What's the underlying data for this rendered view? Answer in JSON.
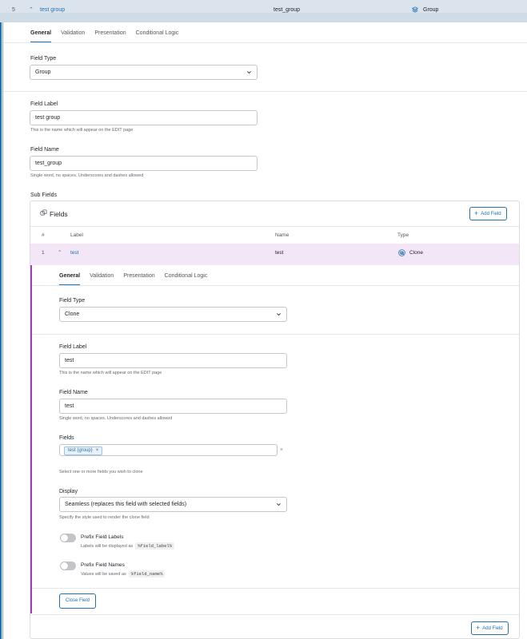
{
  "outer_row": {
    "num": "5",
    "label": "test group",
    "name": "test_group",
    "type": "Group"
  },
  "outer_tabs": [
    "General",
    "Validation",
    "Presentation",
    "Conditional Logic"
  ],
  "outer": {
    "field_type_label": "Field Type",
    "field_type_value": "Group",
    "field_label_label": "Field Label",
    "field_label_value": "test group",
    "field_label_help": "This is the name which will appear on the EDIT page",
    "field_name_label": "Field Name",
    "field_name_value": "test_group",
    "field_name_help": "Single word, no spaces. Underscores and dashes allowed",
    "sub_fields_label": "Sub Fields"
  },
  "sub_panel": {
    "title": "Fields",
    "add_field": "Add Field",
    "columns": [
      "#",
      "Label",
      "Name",
      "Type"
    ],
    "row": {
      "num": "1",
      "label": "test",
      "name": "test",
      "type": "Clone"
    }
  },
  "inner_tabs": [
    "General",
    "Validation",
    "Presentation",
    "Conditional Logic"
  ],
  "inner": {
    "field_type_label": "Field Type",
    "field_type_value": "Clone",
    "field_label_label": "Field Label",
    "field_label_value": "test",
    "field_label_help": "This is the name which will appear on the EDIT page",
    "field_name_label": "Field Name",
    "field_name_value": "test",
    "field_name_help": "Single word, no spaces. Underscores and dashes allowed",
    "fields_label": "Fields",
    "fields_tag": "test (group)",
    "fields_help": "Select one or more fields you wish to clone",
    "display_label": "Display",
    "display_value": "Seamless (replaces this field with selected fields)",
    "display_help": "Specify the style used to render the clone field",
    "prefix_labels_title": "Prefix Field Labels",
    "prefix_labels_help": "Labels will be displayed as",
    "prefix_labels_code": "%field_label%",
    "prefix_names_title": "Prefix Field Names",
    "prefix_names_help": "Values will be saved as",
    "prefix_names_code": "%field_name%",
    "close_field": "Close Field"
  },
  "bottom_add_field": "Add Field",
  "colors": {
    "accent": "#2271b1",
    "sub_accent": "#a23db8",
    "row_highlight": "#f3e6f6"
  }
}
